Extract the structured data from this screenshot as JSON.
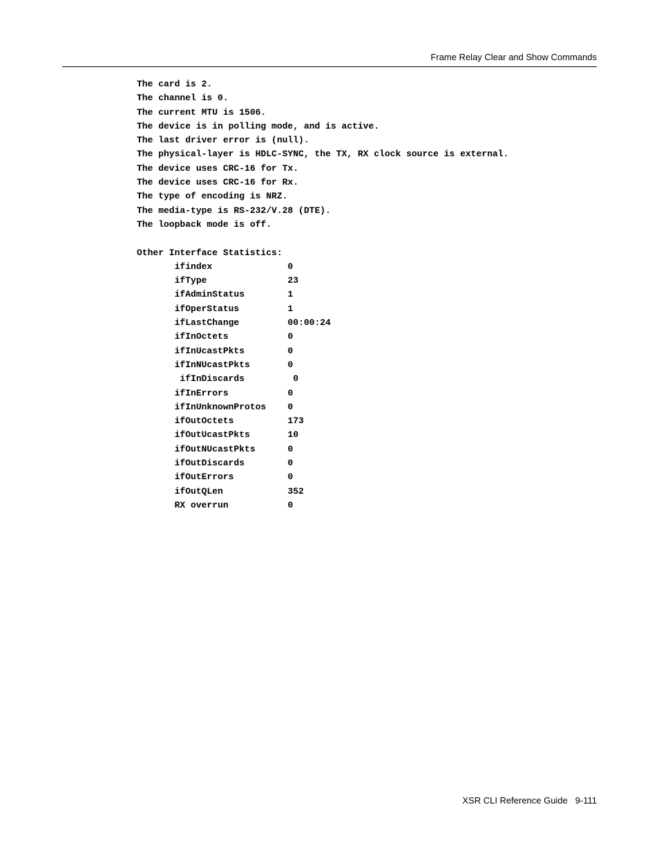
{
  "header": {
    "title": "Frame Relay Clear and Show Commands"
  },
  "body": {
    "lines": [
      "The card is 2.",
      "The channel is 0.",
      "The current MTU is 1506.",
      "The device is in polling mode, and is active.",
      "The last driver error is (null).",
      "The physical-layer is HDLC-SYNC, the TX, RX clock source is external.",
      "The device uses CRC-16 for Tx.",
      "The device uses CRC-16 for Rx.",
      "The type of encoding is NRZ.",
      "The media-type is RS-232/V.28 (DTE).",
      "The loopback mode is off."
    ],
    "stats_header": "Other Interface Statistics:",
    "indent": "       ",
    "label_width": 21,
    "stats": [
      {
        "label": "ifindex",
        "value": "0"
      },
      {
        "label": "ifType",
        "value": "23"
      },
      {
        "label": "ifAdminStatus",
        "value": "1"
      },
      {
        "label": "ifOperStatus",
        "value": "1"
      },
      {
        "label": "ifLastChange",
        "value": "00:00:24"
      },
      {
        "label": "ifInOctets",
        "value": "0"
      },
      {
        "label": "ifInUcastPkts",
        "value": "0"
      },
      {
        "label": "ifInNUcastPkts",
        "value": "0"
      },
      {
        "label": " ifInDiscards",
        "value": " 0"
      },
      {
        "label": "ifInErrors",
        "value": "0"
      },
      {
        "label": "ifInUnknownProtos",
        "value": "0"
      },
      {
        "label": "ifOutOctets",
        "value": "173"
      },
      {
        "label": "ifOutUcastPkts",
        "value": "10"
      },
      {
        "label": "ifOutNUcastPkts",
        "value": "0"
      },
      {
        "label": "ifOutDiscards",
        "value": "0"
      },
      {
        "label": "ifOutErrors",
        "value": "0"
      },
      {
        "label": "ifOutQLen",
        "value": "352"
      },
      {
        "label": "RX overrun",
        "value": "0"
      }
    ]
  },
  "footer": {
    "book": "XSR CLI Reference Guide",
    "page": "9-111"
  }
}
